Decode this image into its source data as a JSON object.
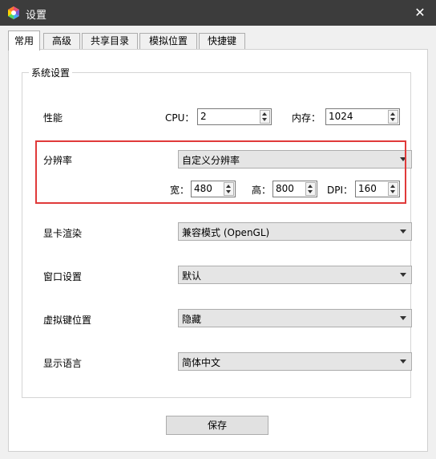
{
  "window": {
    "title": "设置"
  },
  "tabs": [
    {
      "label": "常用"
    },
    {
      "label": "高级"
    },
    {
      "label": "共享目录"
    },
    {
      "label": "模拟位置"
    },
    {
      "label": "快捷键"
    }
  ],
  "group": {
    "title": "系统设置",
    "performance": {
      "label": "性能",
      "cpu_label": "CPU：",
      "cpu_value": "2",
      "mem_label": "内存：",
      "mem_value": "1024"
    },
    "resolution": {
      "label": "分辨率",
      "selected": "自定义分辨率",
      "width_label": "宽：",
      "width_value": "480",
      "height_label": "高：",
      "height_value": "800",
      "dpi_label": "DPI：",
      "dpi_value": "160"
    },
    "renderer": {
      "label": "显卡渲染",
      "selected": "兼容模式 (OpenGL)"
    },
    "window_setting": {
      "label": "窗口设置",
      "selected": "默认"
    },
    "vkey_position": {
      "label": "虚拟键位置",
      "selected": "隐藏"
    },
    "language": {
      "label": "显示语言",
      "selected": "简体中文"
    }
  },
  "save_label": "保存",
  "colors": {
    "titlebar": "#3c3c3c",
    "highlight": "#e03a3a"
  }
}
